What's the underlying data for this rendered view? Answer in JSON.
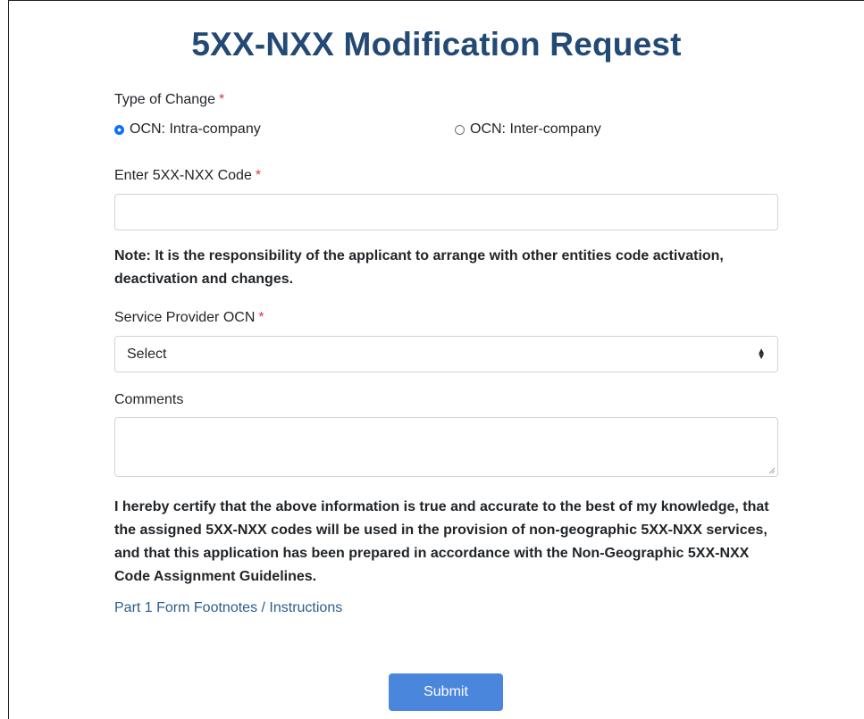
{
  "page": {
    "title": "5XX-NXX Modification Request"
  },
  "type_of_change": {
    "label": "Type of Change",
    "required_marker": "*",
    "options": [
      {
        "label": "OCN: Intra-company",
        "checked": true
      },
      {
        "label": "OCN: Inter-company",
        "checked": false
      }
    ]
  },
  "code_field": {
    "label": "Enter 5XX-NXX Code",
    "required_marker": "*",
    "value": ""
  },
  "note": "Note: It is the responsibility of the applicant to arrange with other entities code activation, deactivation and changes.",
  "ocn_field": {
    "label": "Service Provider OCN",
    "required_marker": "*",
    "selected": "Select",
    "arrow_icon": "select-arrows-icon"
  },
  "comments_field": {
    "label": "Comments",
    "value": ""
  },
  "certification": "I hereby certify that the above information is true and accurate to the best of my knowledge, that the assigned 5XX-NXX codes will be used in the provision of non-geographic 5XX-NXX services, and that this application has been prepared in accordance with the Non-Geographic 5XX-NXX Code Assignment Guidelines.",
  "footnotes_link": "Part 1 Form Footnotes / Instructions",
  "submit_label": "Submit",
  "colors": {
    "title": "#234a74",
    "required": "#dc3545",
    "link": "#2d5d8b",
    "submit_bg": "#4a86dc",
    "radio_checked": "#0d6efd"
  }
}
